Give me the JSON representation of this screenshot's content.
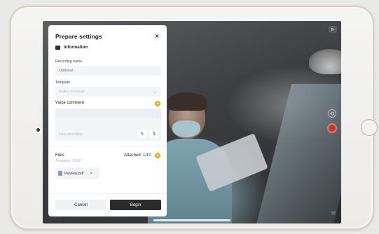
{
  "dialog": {
    "title": "Prepare settings",
    "close_glyph": "✕",
    "section_title": "Information",
    "recording_name": {
      "label": "Recording name",
      "placeholder": "Optional",
      "value": ""
    },
    "template": {
      "label": "Template",
      "placeholder": "Select template",
      "chevron": "⌄"
    },
    "voice_comment": {
      "label": "Voice comment",
      "add_glyph": "+",
      "new_recording_placeholder": "New recording",
      "edit_glyph": "✎",
      "mic_glyph": "🎙"
    },
    "files": {
      "label": "Files",
      "available": "Available: 25MB",
      "attached": "Attached: 1/10",
      "add_glyph": "+",
      "items": [
        {
          "name": "Review.pdf",
          "remove_glyph": "✕"
        }
      ]
    },
    "cancel_label": "Cancel",
    "begin_label": "Begin"
  },
  "camera": {
    "top_control_glyph": "⊳",
    "flip_glyph": "⟲",
    "bottom_control_glyph": "⊟"
  },
  "colors": {
    "accent": "#f5a623",
    "begin_button": "#2b2b2b",
    "record_button": "#c0392b"
  },
  "icons": {
    "section": "info-icon",
    "file": "pdf-file-icon",
    "edit": "pencil-icon",
    "mic": "microphone-icon",
    "record": "record-icon",
    "flip": "flip-camera-icon"
  }
}
